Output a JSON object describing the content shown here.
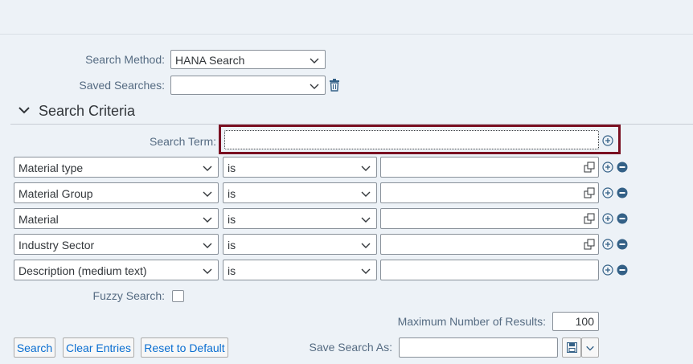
{
  "header": {
    "search_method_label": "Search Method:",
    "search_method_value": "HANA Search",
    "saved_searches_label": "Saved Searches:",
    "saved_searches_value": ""
  },
  "section": {
    "title": "Search Criteria"
  },
  "search_term": {
    "label": "Search Term:",
    "value": ""
  },
  "criteria_rows": [
    {
      "field": "Material type",
      "operator": "is",
      "value": ""
    },
    {
      "field": "Material Group",
      "operator": "is",
      "value": ""
    },
    {
      "field": "Material",
      "operator": "is",
      "value": ""
    },
    {
      "field": "Industry Sector",
      "operator": "is",
      "value": ""
    },
    {
      "field": "Description (medium text)",
      "operator": "is",
      "value": ""
    }
  ],
  "fuzzy": {
    "label": "Fuzzy Search:",
    "checked": false
  },
  "max_results": {
    "label": "Maximum Number of Results:",
    "value": "100"
  },
  "buttons": {
    "search": "Search",
    "clear": "Clear Entries",
    "reset": "Reset to Default"
  },
  "save_search": {
    "label": "Save Search As:",
    "value": ""
  },
  "colors": {
    "highlight": "#7a1022",
    "accent": "#0a6ed1",
    "icon": "#346187"
  }
}
